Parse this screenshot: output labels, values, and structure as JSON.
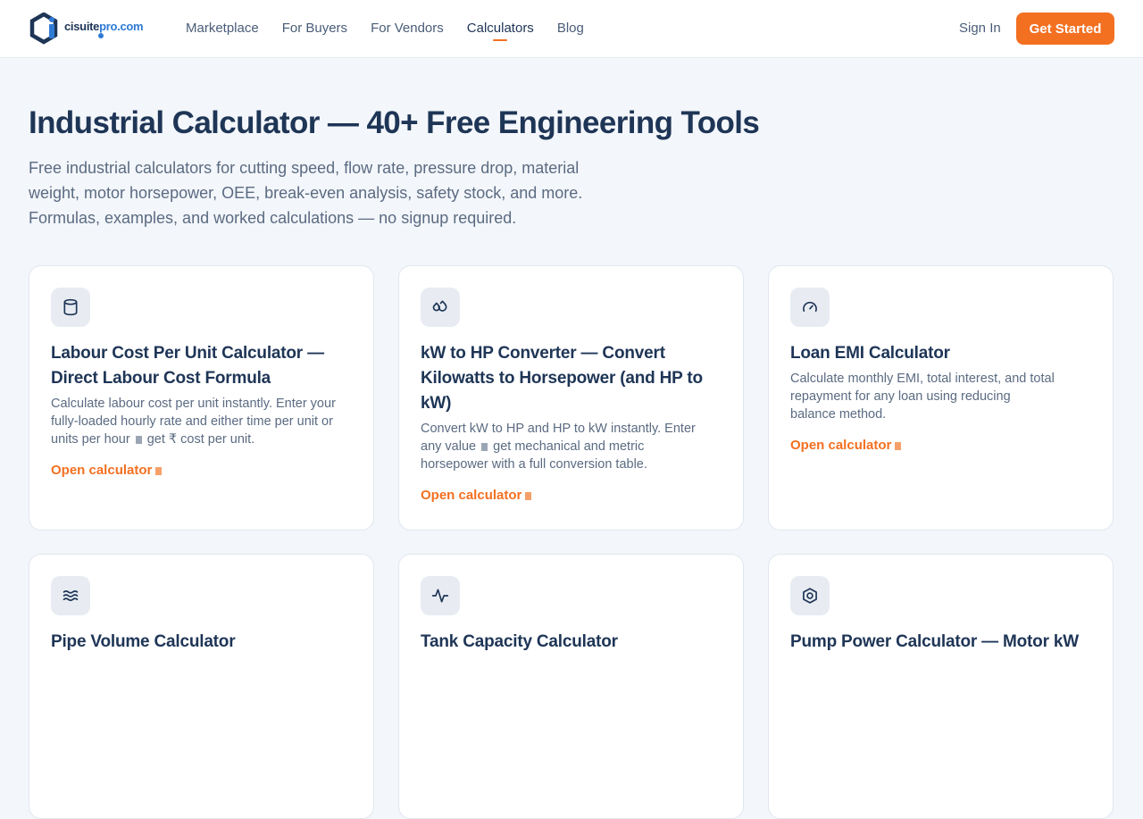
{
  "header": {
    "logo": {
      "brand": "cisuite",
      "domain": "pro.com"
    },
    "nav": [
      "Marketplace",
      "For Buyers",
      "For Vendors",
      "Calculators",
      "Blog"
    ],
    "active_nav": "Calculators",
    "sign_in": "Sign In",
    "cta": "Get Started"
  },
  "hero": {
    "title": "Industrial Calculator — 40+ Free Engineering Tools",
    "subtitle": "Free industrial calculators for cutting speed, flow rate, pressure drop, material weight, motor horsepower, OEE, break-even analysis, safety stock, and more. Formulas, examples, and worked calculations — no signup required."
  },
  "cards": [
    {
      "icon": "cylinder-icon",
      "title": "Labour Cost Per Unit Calculator — Direct Labour Cost Formula",
      "desc_a": "Calculate labour cost per unit instantly. Enter your fully-loaded hourly rate and either time per unit or units per hour",
      "desc_b": "get ₹ cost per unit.",
      "link": "Open calculator"
    },
    {
      "icon": "droplets-icon",
      "title": "kW to HP Converter — Convert Kilowatts to Horsepower (and HP to kW)",
      "desc_a": "Convert kW to HP and HP to kW instantly. Enter any value",
      "desc_b": "get mechanical and metric horsepower with a full conversion table.",
      "link": "Open calculator"
    },
    {
      "icon": "gauge-icon",
      "title": "Loan EMI Calculator",
      "desc_a": "Calculate monthly EMI, total interest, and total repayment for any loan using reducing balance method.",
      "desc_b": "",
      "link": "Open calculator"
    },
    {
      "icon": "waves-icon",
      "title": "Pipe Volume Calculator",
      "desc_a": "",
      "desc_b": "",
      "link": ""
    },
    {
      "icon": "activity-icon",
      "title": "Tank Capacity Calculator",
      "desc_a": "",
      "desc_b": "",
      "link": ""
    },
    {
      "icon": "hexagon-icon",
      "title": "Pump Power Calculator — Motor kW",
      "desc_a": "",
      "desc_b": "",
      "link": ""
    }
  ],
  "colors": {
    "accent": "#f37021",
    "navy": "#1e3556",
    "page_bg": "#f3f6fa"
  }
}
